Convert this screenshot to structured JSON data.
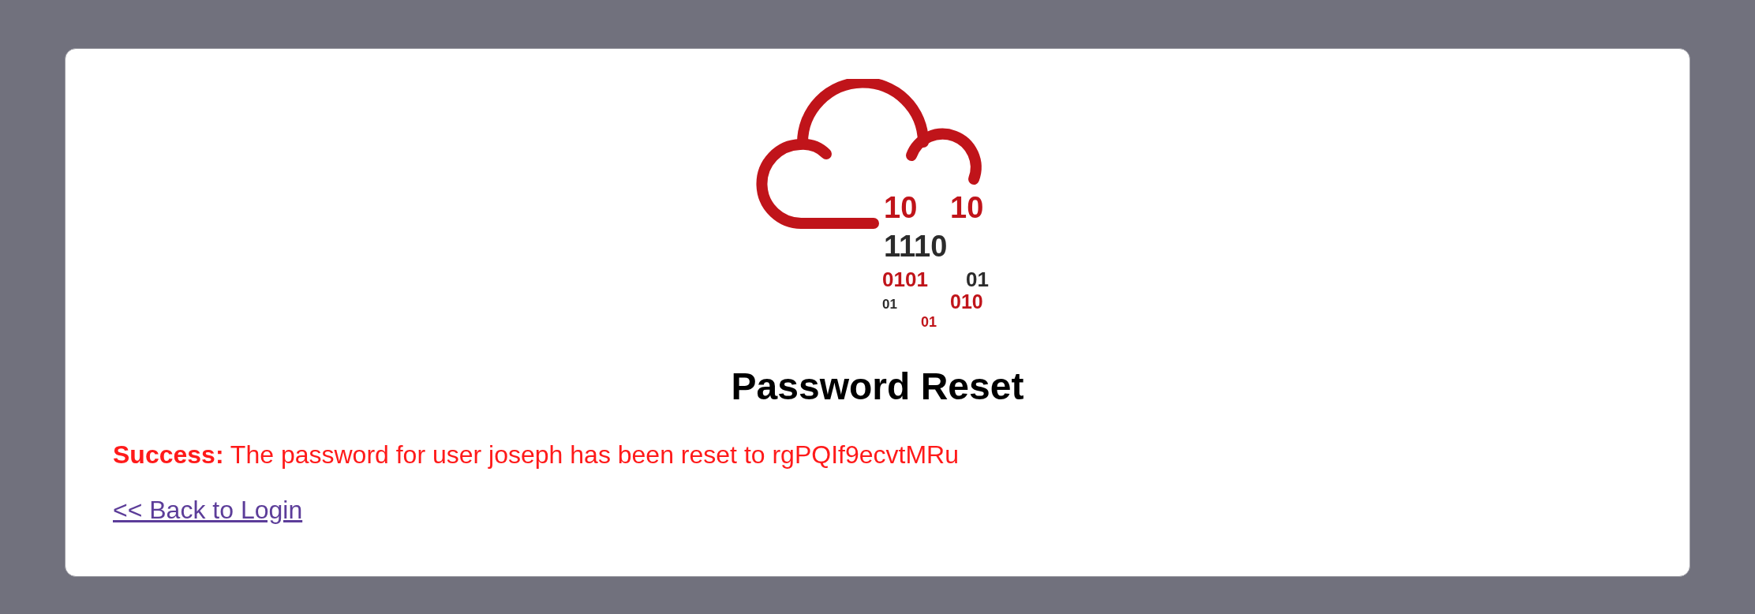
{
  "logo": {
    "digits": [
      {
        "text": "10",
        "color": "#c0141a"
      },
      {
        "text": "10",
        "color": "#c0141a"
      },
      {
        "text": "1110",
        "color": "#2b2b2b"
      },
      {
        "text": "0101",
        "color": "#c0141a"
      },
      {
        "text": "01",
        "color": "#2b2b2b"
      },
      {
        "text": "01",
        "color": "#2b2b2b"
      },
      {
        "text": "010",
        "color": "#c0141a"
      },
      {
        "text": "01",
        "color": "#c0141a"
      }
    ]
  },
  "title": "Password Reset",
  "message": "**Success:** The password for user joseph has been reset to rgPQIf9ecvtMRu",
  "link": "<< Back to Login"
}
